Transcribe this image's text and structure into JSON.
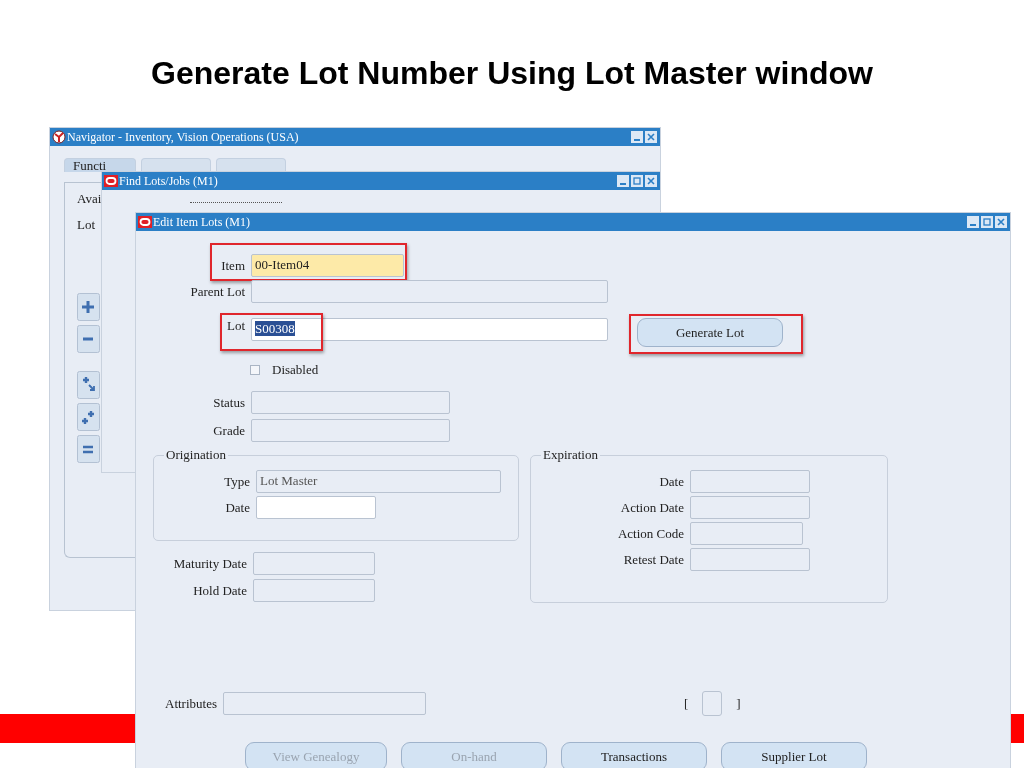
{
  "slide": {
    "title": "Generate Lot Number Using Lot Master window"
  },
  "navigator": {
    "title": "Navigator - Inventory, Vision Operations (USA)",
    "tabs": [
      {
        "label": "Functi",
        "selected": true
      },
      {
        "selected": false
      },
      {
        "selected": false
      }
    ],
    "items": [
      "Avai",
      "Lot"
    ]
  },
  "find_window": {
    "title": "Find Lots/Jobs (M1)"
  },
  "edit_window": {
    "title": "Edit Item Lots (M1)",
    "fields": [
      {
        "label": "Item",
        "value": "00-Item04",
        "kind": "required",
        "highlighted": true
      },
      {
        "label": "Parent Lot",
        "kind": "readonly",
        "highlighted": false
      },
      {
        "label": "Lot",
        "value": "S00308",
        "value_selected": true,
        "kind": "input",
        "highlighted": true
      }
    ],
    "generate_button": {
      "label": "Generate Lot",
      "highlighted": true
    },
    "disabled_checkbox": {
      "label": "Disabled",
      "checked": false
    },
    "status_fields": [
      {
        "label": "Status",
        "kind": "readonly"
      },
      {
        "label": "Grade",
        "kind": "readonly"
      }
    ],
    "origination": {
      "title": "Origination",
      "fields": [
        {
          "label": "Type",
          "value": "Lot Master",
          "kind": "readonly"
        },
        {
          "label": "Date",
          "kind": "input"
        }
      ]
    },
    "dates": [
      {
        "label": "Maturity Date",
        "kind": "readonly"
      },
      {
        "label": "Hold Date",
        "kind": "readonly"
      }
    ],
    "expiration": {
      "title": "Expiration",
      "fields": [
        {
          "label": "Date",
          "kind": "readonly"
        },
        {
          "label": "Action Date",
          "kind": "readonly"
        },
        {
          "label": "Action Code",
          "kind": "readonly"
        },
        {
          "label": "Retest Date",
          "kind": "readonly"
        }
      ]
    },
    "attributes": {
      "label": "Attributes",
      "kind": "readonly"
    },
    "bracket_field": {
      "open": "[",
      "close": "]"
    },
    "buttons": [
      {
        "label": "View Genealogy",
        "disabled": true
      },
      {
        "label": "On-hand",
        "disabled": true
      },
      {
        "label": "Transactions",
        "disabled": false
      },
      {
        "label": "Supplier Lot",
        "disabled": false
      }
    ]
  }
}
